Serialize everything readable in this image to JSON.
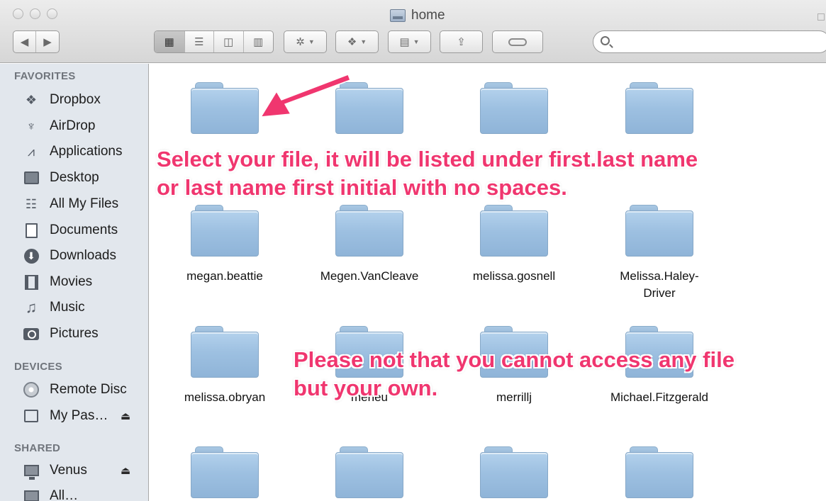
{
  "window": {
    "title": "home"
  },
  "toolbar": {
    "back_icon": "chevron-left-icon",
    "forward_icon": "chevron-right-icon",
    "views": [
      "icon-view-icon",
      "list-view-icon",
      "column-view-icon",
      "coverflow-view-icon"
    ],
    "active_view": "icon-view-icon",
    "action_icon": "gear-icon",
    "dropbox_icon": "dropbox-icon",
    "arrange_icon": "arrange-icon",
    "share_icon": "share-icon",
    "tag_icon": "tag-icon",
    "search_value": "",
    "search_placeholder": ""
  },
  "sidebar": {
    "favorites_heading": "FAVORITES",
    "favorites": [
      {
        "label": "Dropbox",
        "icon": "dropbox-icon"
      },
      {
        "label": "AirDrop",
        "icon": "airdrop-icon"
      },
      {
        "label": "Applications",
        "icon": "applications-icon"
      },
      {
        "label": "Desktop",
        "icon": "desktop-icon"
      },
      {
        "label": "All My Files",
        "icon": "all-files-icon"
      },
      {
        "label": "Documents",
        "icon": "documents-icon"
      },
      {
        "label": "Downloads",
        "icon": "downloads-icon"
      },
      {
        "label": "Movies",
        "icon": "movies-icon"
      },
      {
        "label": "Music",
        "icon": "music-icon"
      },
      {
        "label": "Pictures",
        "icon": "pictures-icon"
      }
    ],
    "devices_heading": "DEVICES",
    "devices": [
      {
        "label": "Remote Disc",
        "icon": "disc-icon"
      },
      {
        "label": "My Pas…",
        "icon": "drive-icon",
        "eject": "⏏"
      }
    ],
    "shared_heading": "SHARED",
    "shared": [
      {
        "label": "Venus",
        "icon": "monitor-icon",
        "eject": "⏏"
      },
      {
        "label": "All…",
        "icon": "network-icon"
      }
    ]
  },
  "files": {
    "row2": [
      "megan.beattie",
      "Megen.VanCleave",
      "melissa.gosnell",
      "Melissa.Haley-Driver"
    ],
    "row3": [
      "melissa.obryan",
      "meneu",
      "merrillj",
      "Michael.Fitzgerald"
    ]
  },
  "annotations": {
    "note1_line1": "Select your file, it will be listed under first.last name",
    "note1_line2": "or last name first initial with no spaces.",
    "note2_line1": "Please not that you cannot access any file",
    "note2_line2": "but your own.",
    "color": "#f0366f"
  }
}
